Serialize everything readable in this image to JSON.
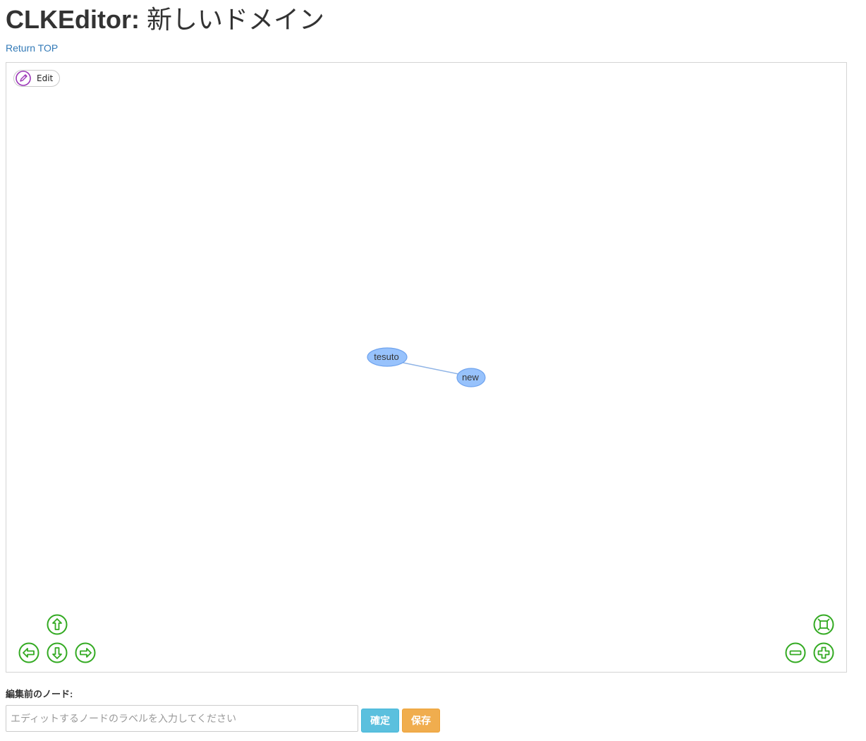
{
  "header": {
    "title_prefix": "CLKEditor:",
    "title_domain": "新しいドメイン",
    "return_link": "Return TOP"
  },
  "graph": {
    "edit_label": "Edit",
    "nodes": [
      {
        "id": "tesuto",
        "label": "tesuto"
      },
      {
        "id": "new",
        "label": "new"
      }
    ],
    "edges": [
      {
        "from": "tesuto",
        "to": "new"
      }
    ],
    "colors": {
      "node_fill": "#97c2fc",
      "node_border": "#2b7ce9",
      "edge": "#848484",
      "nav_icon": "#33aa22",
      "edit_icon": "#9b36b7"
    },
    "navigation": {
      "up_icon": "arrow-up-icon",
      "down_icon": "arrow-down-icon",
      "left_icon": "arrow-left-icon",
      "right_icon": "arrow-right-icon",
      "zoom_in_icon": "zoom-in-icon",
      "zoom_out_icon": "zoom-out-icon",
      "fit_icon": "zoom-extends-icon"
    }
  },
  "form": {
    "heading": "編集前のノード:",
    "input_value": "",
    "input_placeholder": "エディットするノードのラベルを入力してください",
    "confirm_label": "確定",
    "save_label": "保存"
  }
}
